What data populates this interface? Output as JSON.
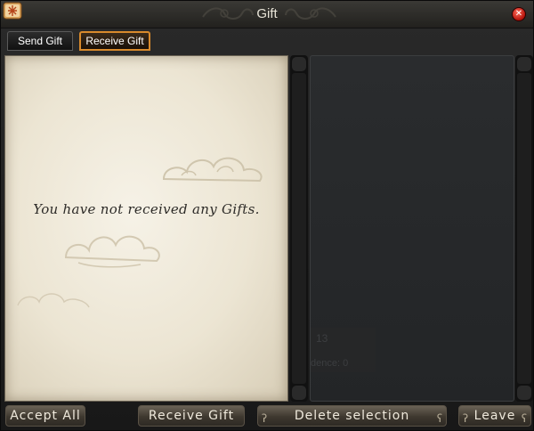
{
  "window": {
    "title": "Gift"
  },
  "tabs": [
    {
      "label": "Send Gift",
      "active": false
    },
    {
      "label": "Receive Gift",
      "active": true
    }
  ],
  "gift_list": {
    "empty_message": "You have not received any Gifts."
  },
  "detail_panel": {
    "ghost_count": "13",
    "ghost_label": "dence: 0"
  },
  "buttons": {
    "accept_all": "Accept All",
    "receive_gift": "Receive Gift",
    "delete_selection": "Delete selection",
    "leave": "Leave"
  },
  "colors": {
    "active_tab_border": "#d98a2c",
    "parchment": "#ece5d3",
    "close_button": "#b3120a"
  },
  "icons": {
    "app": "gift-scroll-icon",
    "close": "close-icon"
  }
}
